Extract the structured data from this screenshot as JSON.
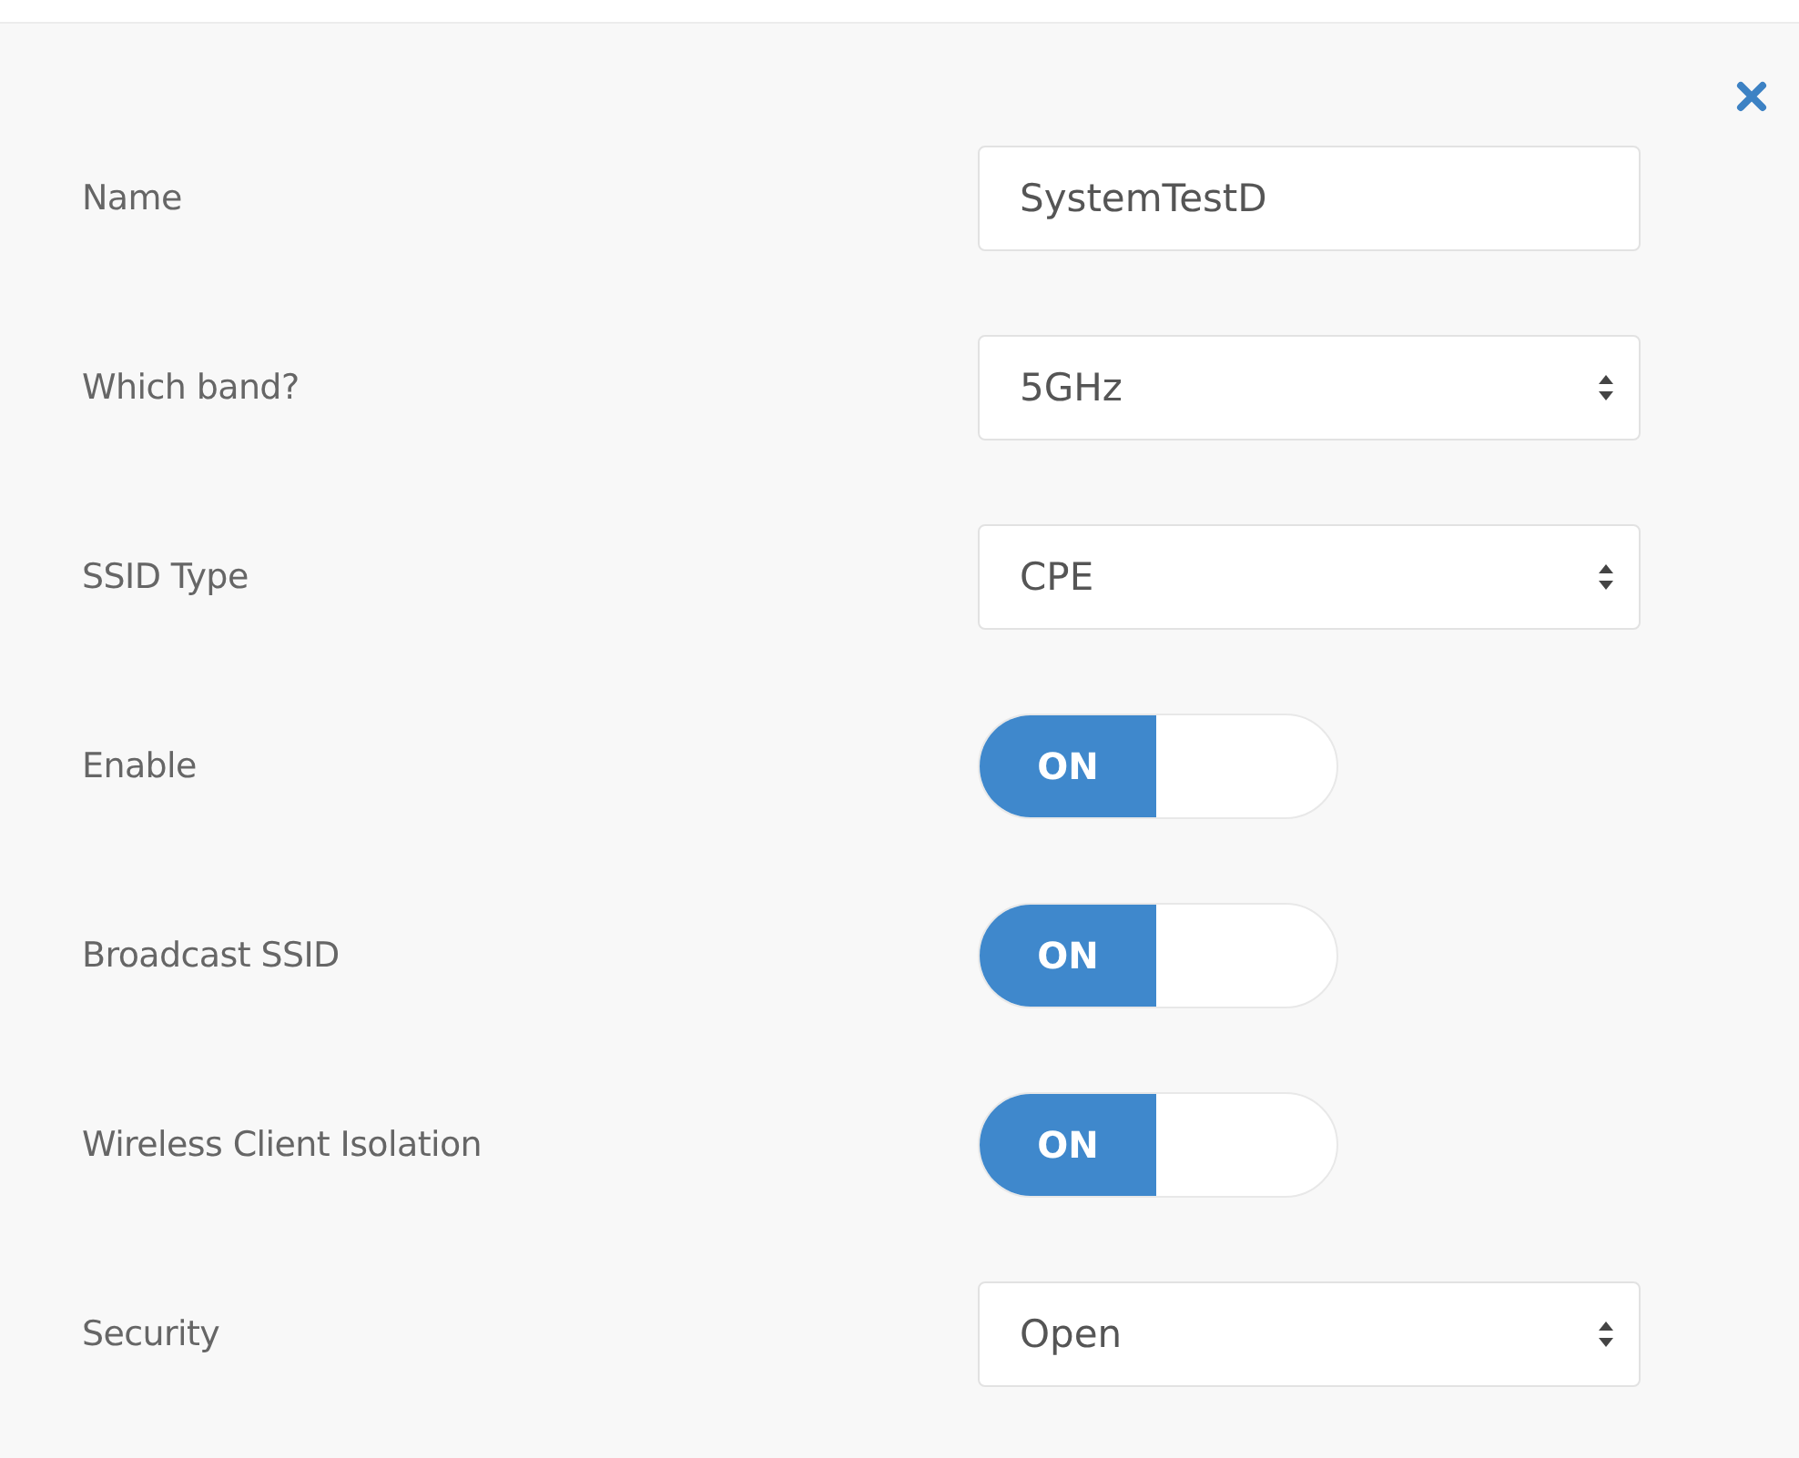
{
  "fields": [
    {
      "kind": "text",
      "label": "Name",
      "value": "SystemTestD"
    },
    {
      "kind": "select",
      "label": "Which band?",
      "value": "5GHz"
    },
    {
      "kind": "select",
      "label": "SSID Type",
      "value": "CPE"
    },
    {
      "kind": "toggle",
      "label": "Enable",
      "on": true,
      "text": "ON"
    },
    {
      "kind": "toggle",
      "label": "Broadcast SSID",
      "on": true,
      "text": "ON"
    },
    {
      "kind": "toggle",
      "label": "Wireless Client Isolation",
      "on": true,
      "text": "ON"
    },
    {
      "kind": "select",
      "label": "Security",
      "value": "Open"
    }
  ]
}
